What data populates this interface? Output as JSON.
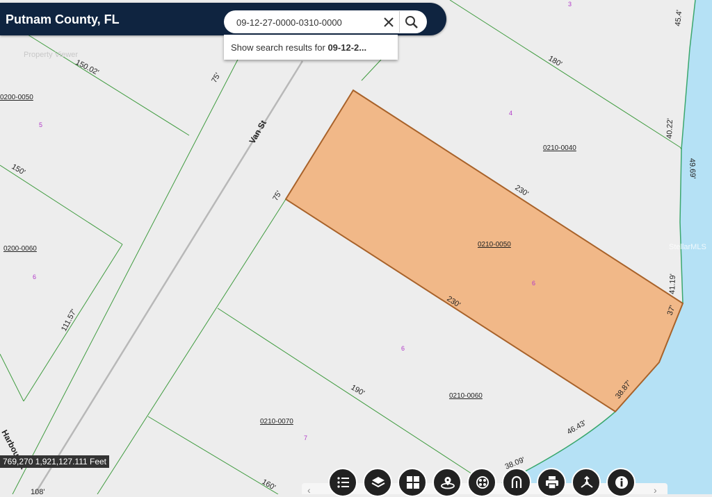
{
  "header": {
    "title": "Putnam County, FL"
  },
  "search": {
    "value": "09-12-27-0000-0310-0000",
    "suggestion_prefix": "Show search results for ",
    "suggestion_bold": "09-12-2..."
  },
  "map": {
    "street_labels": [
      "Van St",
      "Harbour St"
    ],
    "parcel_ids": [
      "0210-0040",
      "0210-0050",
      "0210-0060",
      "0210-0070",
      "0200-0050",
      "0200-0060"
    ],
    "lot_numbers": [
      "3",
      "4",
      "5",
      "6",
      "6",
      "6",
      "7"
    ],
    "dimensions": [
      "150.02'",
      "75'",
      "180'",
      "45.4'",
      "40.22'",
      "49.69'",
      "230'",
      "75'",
      "150'",
      "111.57'",
      "230'",
      "41.19'",
      "37'",
      "38.87'",
      "46.43'",
      "190'",
      "38.09'",
      "160'",
      "108'"
    ],
    "watermark": "StellarMLS",
    "ghost_text": "Property Viewer",
    "colors": {
      "selected_fill": "#f1b888",
      "selected_stroke": "#a8622a",
      "parcel_line": "#3f9b3f",
      "water": "#b5e1f5"
    }
  },
  "coordinates": "769,270 1,921,127.111 Feet",
  "toolbar": {
    "icons": [
      "legend-icon",
      "layers-icon",
      "basemap-icon",
      "locate-icon",
      "print-icon",
      "measure-icon",
      "printer-icon",
      "share-icon",
      "info-icon"
    ]
  }
}
